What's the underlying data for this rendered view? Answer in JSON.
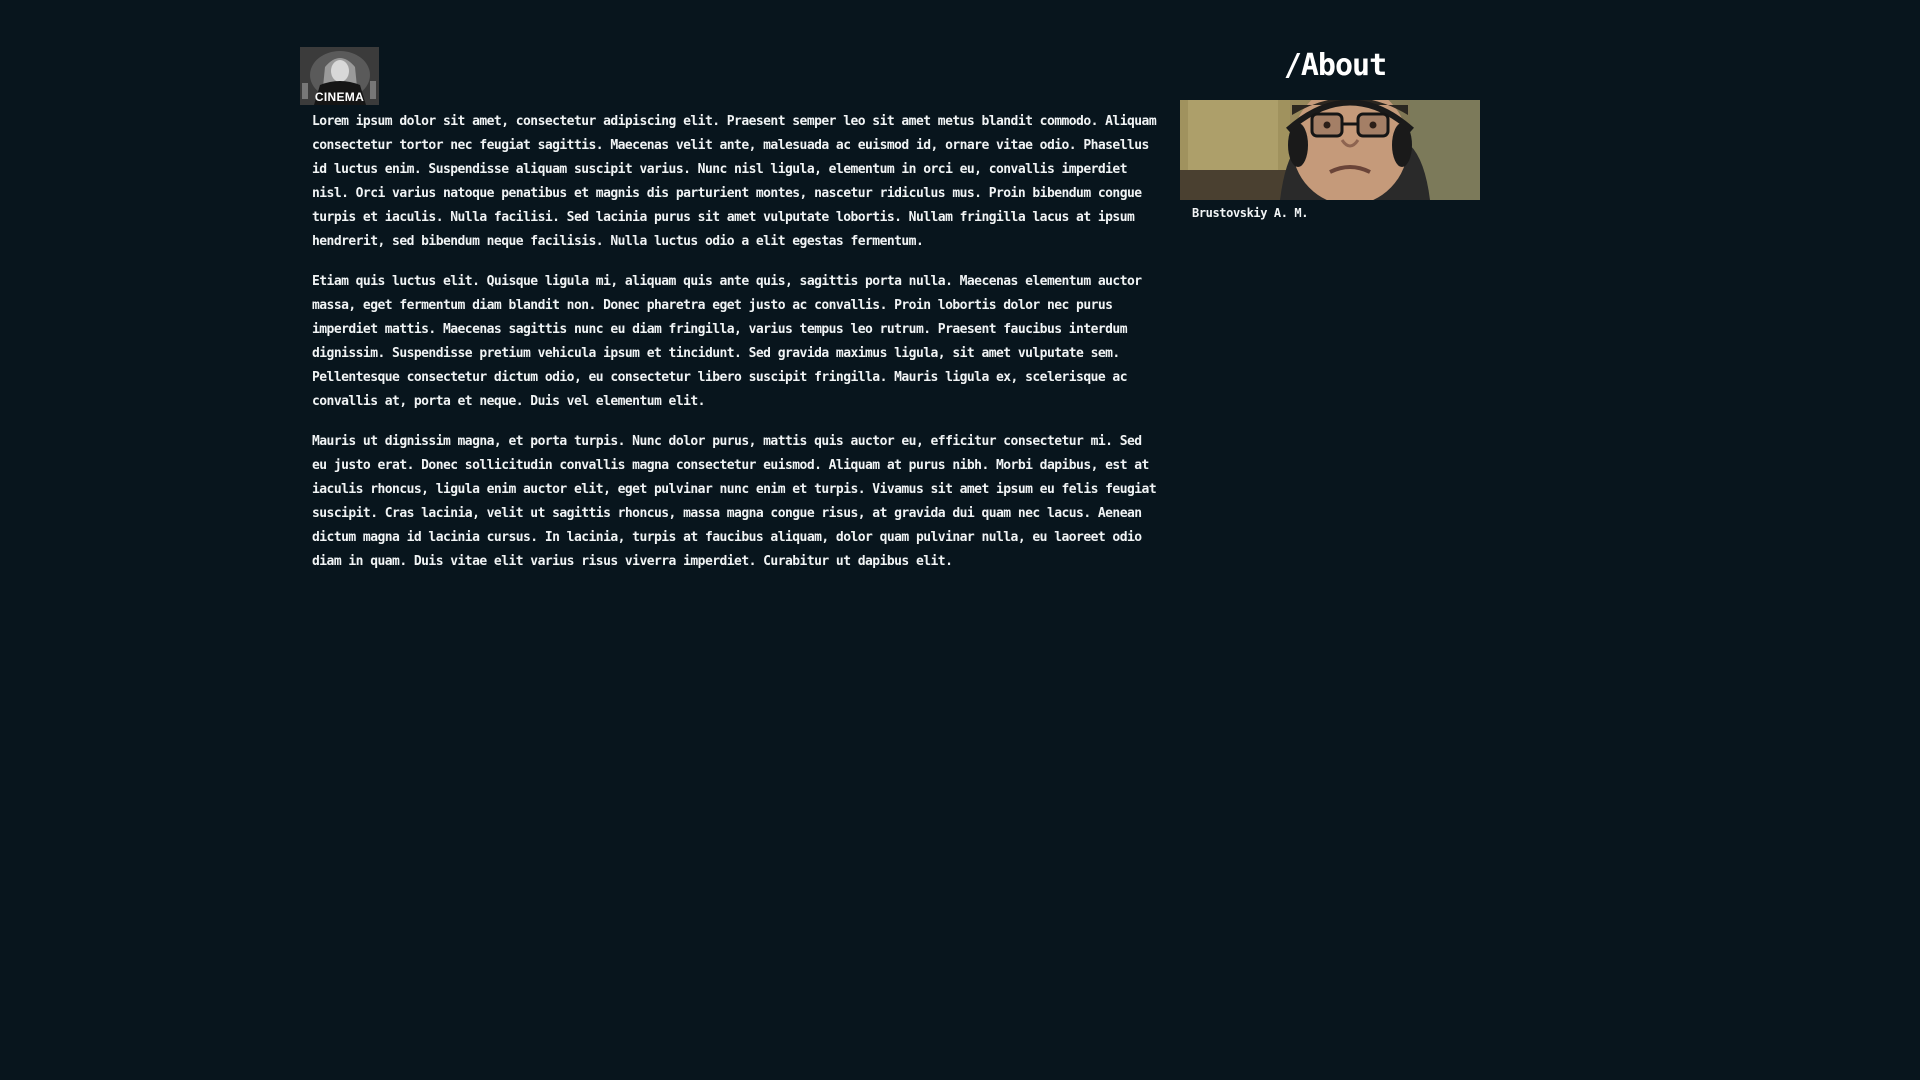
{
  "logo": {
    "caption": "CINEMA"
  },
  "main": {
    "paragraphs": [
      "Lorem ipsum dolor sit amet, consectetur adipiscing elit. Praesent semper leo sit amet metus blandit commodo. Aliquam consectetur tortor nec feugiat sagittis. Maecenas velit ante, malesuada ac euismod id, ornare vitae odio. Phasellus id luctus enim. Suspendisse aliquam suscipit varius. Nunc nisl ligula, elementum in orci eu, convallis imperdiet nisl. Orci varius natoque penatibus et magnis dis parturient montes, nascetur ridiculus mus. Proin bibendum congue turpis et iaculis. Nulla facilisi. Sed lacinia purus sit amet vulputate lobortis. Nullam fringilla lacus at ipsum hendrerit, sed bibendum neque facilisis. Nulla luctus odio a elit egestas fermentum.",
      "Etiam quis luctus elit. Quisque ligula mi, aliquam quis ante quis, sagittis porta nulla. Maecenas elementum auctor massa, eget fermentum diam blandit non. Donec pharetra eget justo ac convallis. Proin lobortis dolor nec purus imperdiet mattis. Maecenas sagittis nunc eu diam fringilla, varius tempus leo rutrum. Praesent faucibus interdum dignissim. Suspendisse pretium vehicula ipsum et tincidunt. Sed gravida maximus ligula, sit amet vulputate sem. Pellentesque consectetur dictum odio, eu consectetur libero suscipit fringilla. Mauris ligula ex, scelerisque ac convallis at, porta et neque. Duis vel elementum elit.",
      "Mauris ut dignissim magna, et porta turpis. Nunc dolor purus, mattis quis auctor eu, efficitur consectetur mi. Sed eu justo erat. Donec sollicitudin convallis magna consectetur euismod. Aliquam at purus nibh. Morbi dapibus, est at iaculis rhoncus, ligula enim auctor elit, eget pulvinar nunc enim et turpis. Vivamus sit amet ipsum eu felis feugiat suscipit. Cras lacinia, velit ut sagittis rhoncus, massa magna congue risus, at gravida dui quam nec lacus. Aenean dictum magna id lacinia cursus. In lacinia, turpis at faucibus aliquam, dolor quam pulvinar nulla, eu laoreet odio diam in quam. Duis vitae elit varius risus viverra imperdiet. Curabitur ut dapibus elit."
    ]
  },
  "sidebar": {
    "title": "/About",
    "author_name": "Brustovskiy A. M."
  },
  "colors": {
    "background": "#08151d",
    "text": "#f1f4f5"
  }
}
